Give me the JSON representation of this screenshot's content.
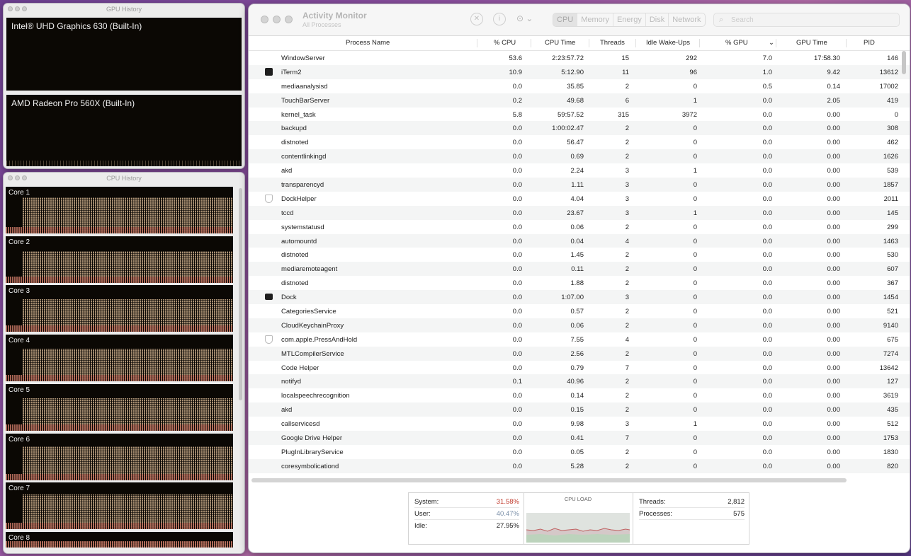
{
  "gpu_window": {
    "title": "GPU History",
    "gpus": [
      "Intel® UHD Graphics 630 (Built-In)",
      "AMD Radeon Pro 560X (Built-In)"
    ]
  },
  "cpu_window": {
    "title": "CPU History",
    "cores": [
      "Core 1",
      "Core 2",
      "Core 3",
      "Core 4",
      "Core 5",
      "Core 6",
      "Core 7",
      "Core 8"
    ]
  },
  "app": {
    "title": "Activity Monitor",
    "subtitle": "All Processes",
    "more_icon": "ellipsis-icon",
    "tabs": [
      "CPU",
      "Memory",
      "Energy",
      "Disk",
      "Network"
    ],
    "active_tab": "CPU",
    "search_placeholder": "Search",
    "columns": {
      "name": "Process Name",
      "cpu": "% CPU",
      "cpu_time": "CPU Time",
      "threads": "Threads",
      "idle_wakeups": "Idle Wake-Ups",
      "gpu": "% GPU",
      "gpu_time": "GPU Time",
      "pid": "PID"
    },
    "processes": [
      {
        "name": "WindowServer",
        "cpu": "53.6",
        "cpu_time": "2:23:57.72",
        "threads": "15",
        "idle": "292",
        "gpu": "7.0",
        "gpu_time": "17:58.30",
        "pid": "146",
        "icon": ""
      },
      {
        "name": "iTerm2",
        "cpu": "10.9",
        "cpu_time": "5:12.90",
        "threads": "11",
        "idle": "96",
        "gpu": "1.0",
        "gpu_time": "9.42",
        "pid": "13612",
        "icon": "dark"
      },
      {
        "name": "mediaanalysisd",
        "cpu": "0.0",
        "cpu_time": "35.85",
        "threads": "2",
        "idle": "0",
        "gpu": "0.5",
        "gpu_time": "0.14",
        "pid": "17002",
        "icon": ""
      },
      {
        "name": "TouchBarServer",
        "cpu": "0.2",
        "cpu_time": "49.68",
        "threads": "6",
        "idle": "1",
        "gpu": "0.0",
        "gpu_time": "2.05",
        "pid": "419",
        "icon": ""
      },
      {
        "name": "kernel_task",
        "cpu": "5.8",
        "cpu_time": "59:57.52",
        "threads": "315",
        "idle": "3972",
        "gpu": "0.0",
        "gpu_time": "0.00",
        "pid": "0",
        "icon": ""
      },
      {
        "name": "backupd",
        "cpu": "0.0",
        "cpu_time": "1:00:02.47",
        "threads": "2",
        "idle": "0",
        "gpu": "0.0",
        "gpu_time": "0.00",
        "pid": "308",
        "icon": ""
      },
      {
        "name": "distnoted",
        "cpu": "0.0",
        "cpu_time": "56.47",
        "threads": "2",
        "idle": "0",
        "gpu": "0.0",
        "gpu_time": "0.00",
        "pid": "462",
        "icon": ""
      },
      {
        "name": "contentlinkingd",
        "cpu": "0.0",
        "cpu_time": "0.69",
        "threads": "2",
        "idle": "0",
        "gpu": "0.0",
        "gpu_time": "0.00",
        "pid": "1626",
        "icon": ""
      },
      {
        "name": "akd",
        "cpu": "0.0",
        "cpu_time": "2.24",
        "threads": "3",
        "idle": "1",
        "gpu": "0.0",
        "gpu_time": "0.00",
        "pid": "539",
        "icon": ""
      },
      {
        "name": "transparencyd",
        "cpu": "0.0",
        "cpu_time": "1.11",
        "threads": "3",
        "idle": "0",
        "gpu": "0.0",
        "gpu_time": "0.00",
        "pid": "1857",
        "icon": ""
      },
      {
        "name": "DockHelper",
        "cpu": "0.0",
        "cpu_time": "4.04",
        "threads": "3",
        "idle": "0",
        "gpu": "0.0",
        "gpu_time": "0.00",
        "pid": "2011",
        "icon": "shield"
      },
      {
        "name": "tccd",
        "cpu": "0.0",
        "cpu_time": "23.67",
        "threads": "3",
        "idle": "1",
        "gpu": "0.0",
        "gpu_time": "0.00",
        "pid": "145",
        "icon": ""
      },
      {
        "name": "systemstatusd",
        "cpu": "0.0",
        "cpu_time": "0.06",
        "threads": "2",
        "idle": "0",
        "gpu": "0.0",
        "gpu_time": "0.00",
        "pid": "299",
        "icon": ""
      },
      {
        "name": "automountd",
        "cpu": "0.0",
        "cpu_time": "0.04",
        "threads": "4",
        "idle": "0",
        "gpu": "0.0",
        "gpu_time": "0.00",
        "pid": "1463",
        "icon": ""
      },
      {
        "name": "distnoted",
        "cpu": "0.0",
        "cpu_time": "1.45",
        "threads": "2",
        "idle": "0",
        "gpu": "0.0",
        "gpu_time": "0.00",
        "pid": "530",
        "icon": ""
      },
      {
        "name": "mediaremoteagent",
        "cpu": "0.0",
        "cpu_time": "0.11",
        "threads": "2",
        "idle": "0",
        "gpu": "0.0",
        "gpu_time": "0.00",
        "pid": "607",
        "icon": ""
      },
      {
        "name": "distnoted",
        "cpu": "0.0",
        "cpu_time": "1.88",
        "threads": "2",
        "idle": "0",
        "gpu": "0.0",
        "gpu_time": "0.00",
        "pid": "367",
        "icon": ""
      },
      {
        "name": "Dock",
        "cpu": "0.0",
        "cpu_time": "1:07.00",
        "threads": "3",
        "idle": "0",
        "gpu": "0.0",
        "gpu_time": "0.00",
        "pid": "1454",
        "icon": "dock"
      },
      {
        "name": "CategoriesService",
        "cpu": "0.0",
        "cpu_time": "0.57",
        "threads": "2",
        "idle": "0",
        "gpu": "0.0",
        "gpu_time": "0.00",
        "pid": "521",
        "icon": ""
      },
      {
        "name": "CloudKeychainProxy",
        "cpu": "0.0",
        "cpu_time": "0.06",
        "threads": "2",
        "idle": "0",
        "gpu": "0.0",
        "gpu_time": "0.00",
        "pid": "9140",
        "icon": ""
      },
      {
        "name": "com.apple.PressAndHold",
        "cpu": "0.0",
        "cpu_time": "7.55",
        "threads": "4",
        "idle": "0",
        "gpu": "0.0",
        "gpu_time": "0.00",
        "pid": "675",
        "icon": "shield"
      },
      {
        "name": "MTLCompilerService",
        "cpu": "0.0",
        "cpu_time": "2.56",
        "threads": "2",
        "idle": "0",
        "gpu": "0.0",
        "gpu_time": "0.00",
        "pid": "7274",
        "icon": ""
      },
      {
        "name": "Code Helper",
        "cpu": "0.0",
        "cpu_time": "0.79",
        "threads": "7",
        "idle": "0",
        "gpu": "0.0",
        "gpu_time": "0.00",
        "pid": "13642",
        "icon": ""
      },
      {
        "name": "notifyd",
        "cpu": "0.1",
        "cpu_time": "40.96",
        "threads": "2",
        "idle": "0",
        "gpu": "0.0",
        "gpu_time": "0.00",
        "pid": "127",
        "icon": ""
      },
      {
        "name": "localspeechrecognition",
        "cpu": "0.0",
        "cpu_time": "0.14",
        "threads": "2",
        "idle": "0",
        "gpu": "0.0",
        "gpu_time": "0.00",
        "pid": "3619",
        "icon": ""
      },
      {
        "name": "akd",
        "cpu": "0.0",
        "cpu_time": "0.15",
        "threads": "2",
        "idle": "0",
        "gpu": "0.0",
        "gpu_time": "0.00",
        "pid": "435",
        "icon": ""
      },
      {
        "name": "callservicesd",
        "cpu": "0.0",
        "cpu_time": "9.98",
        "threads": "3",
        "idle": "1",
        "gpu": "0.0",
        "gpu_time": "0.00",
        "pid": "512",
        "icon": ""
      },
      {
        "name": "Google Drive Helper",
        "cpu": "0.0",
        "cpu_time": "0.41",
        "threads": "7",
        "idle": "0",
        "gpu": "0.0",
        "gpu_time": "0.00",
        "pid": "1753",
        "icon": ""
      },
      {
        "name": "PlugInLibraryService",
        "cpu": "0.0",
        "cpu_time": "0.05",
        "threads": "2",
        "idle": "0",
        "gpu": "0.0",
        "gpu_time": "0.00",
        "pid": "1830",
        "icon": ""
      },
      {
        "name": "coresymbolicationd",
        "cpu": "0.0",
        "cpu_time": "5.28",
        "threads": "2",
        "idle": "0",
        "gpu": "0.0",
        "gpu_time": "0.00",
        "pid": "820",
        "icon": ""
      }
    ],
    "summary": {
      "system_label": "System:",
      "system_value": "31.58%",
      "system_color": "#c0392b",
      "user_label": "User:",
      "user_value": "40.47%",
      "user_color": "#2b6fb6",
      "idle_label": "Idle:",
      "idle_value": "27.95%",
      "cpu_load_label": "CPU LOAD",
      "threads_label": "Threads:",
      "threads_value": "2,812",
      "processes_label": "Processes:",
      "processes_value": "575"
    }
  }
}
